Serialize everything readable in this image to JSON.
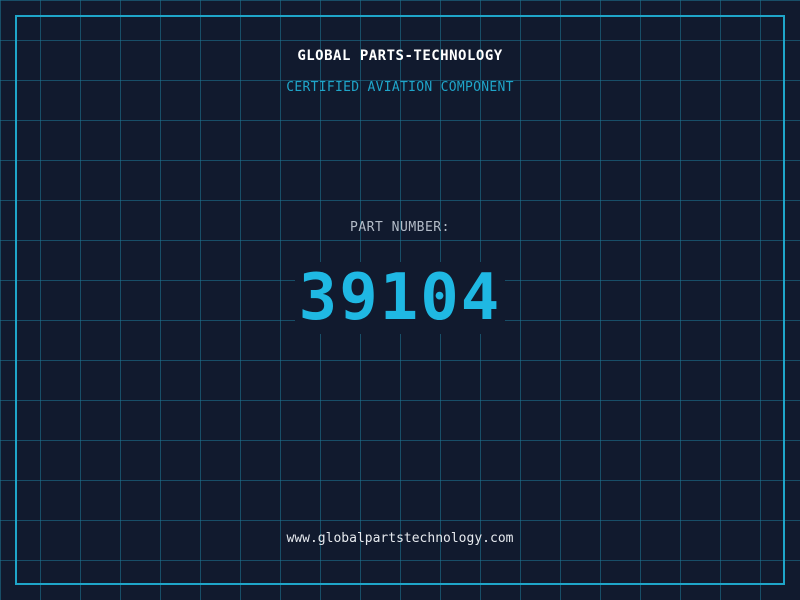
{
  "header": {
    "brand": "GLOBAL PARTS-TECHNOLOGY",
    "tagline": "CERTIFIED AVIATION COMPONENT"
  },
  "part": {
    "label": "PART NUMBER:",
    "number": "39104"
  },
  "footer": {
    "website": "www.globalpartstechnology.com"
  },
  "colors": {
    "background": "#111a2e",
    "grid": "#1e7896",
    "frame": "#1fa5c9",
    "accent": "#1fb8e3",
    "label": "#b4bcc8",
    "text": "#ffffff"
  }
}
